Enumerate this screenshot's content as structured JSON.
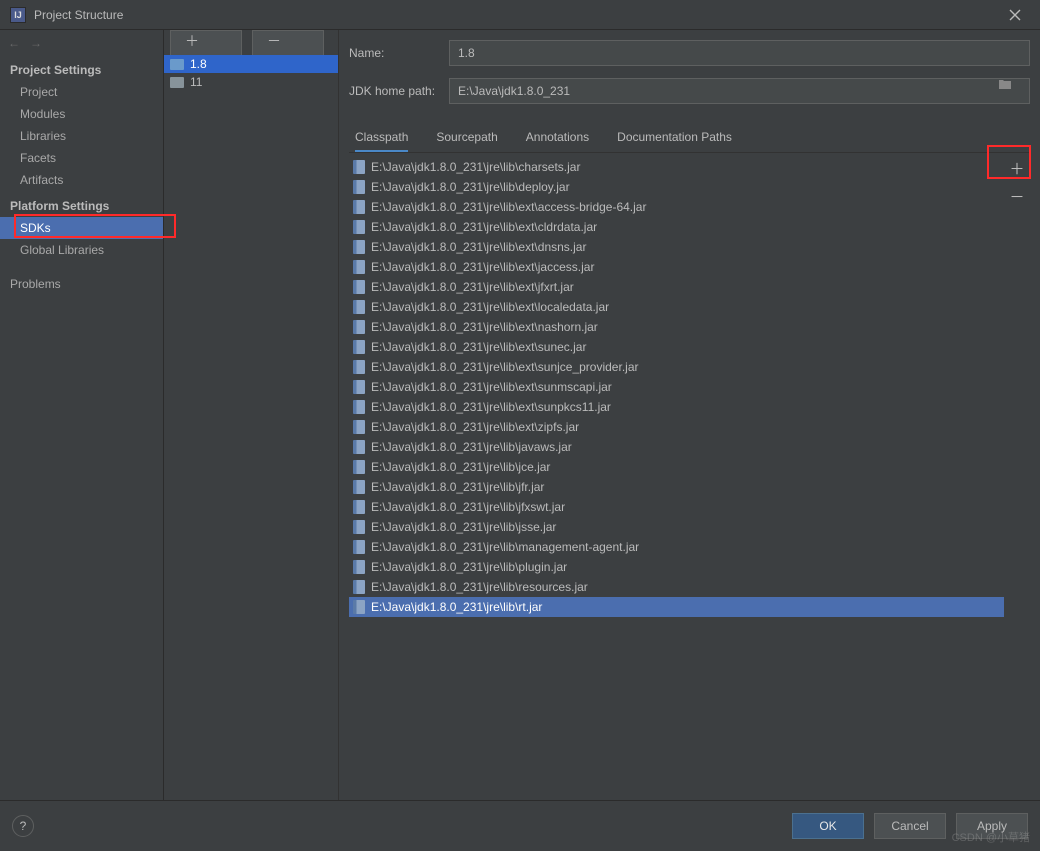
{
  "window": {
    "title": "Project Structure"
  },
  "sidebar": {
    "project_settings_header": "Project Settings",
    "project": "Project",
    "modules": "Modules",
    "libraries": "Libraries",
    "facets": "Facets",
    "artifacts": "Artifacts",
    "platform_settings_header": "Platform Settings",
    "sdks": "SDKs",
    "global_libraries": "Global Libraries",
    "problems": "Problems"
  },
  "sdk_list": {
    "items": [
      {
        "label": "1.8",
        "selected": true
      },
      {
        "label": "11",
        "selected": false
      }
    ]
  },
  "form": {
    "name_label": "Name:",
    "name_value": "1.8",
    "jdk_path_label": "JDK home path:",
    "jdk_path_value": "E:\\Java\\jdk1.8.0_231"
  },
  "tabs": {
    "classpath": "Classpath",
    "sourcepath": "Sourcepath",
    "annotations": "Annotations",
    "docpaths": "Documentation Paths"
  },
  "classpath": {
    "items": [
      "E:\\Java\\jdk1.8.0_231\\jre\\lib\\charsets.jar",
      "E:\\Java\\jdk1.8.0_231\\jre\\lib\\deploy.jar",
      "E:\\Java\\jdk1.8.0_231\\jre\\lib\\ext\\access-bridge-64.jar",
      "E:\\Java\\jdk1.8.0_231\\jre\\lib\\ext\\cldrdata.jar",
      "E:\\Java\\jdk1.8.0_231\\jre\\lib\\ext\\dnsns.jar",
      "E:\\Java\\jdk1.8.0_231\\jre\\lib\\ext\\jaccess.jar",
      "E:\\Java\\jdk1.8.0_231\\jre\\lib\\ext\\jfxrt.jar",
      "E:\\Java\\jdk1.8.0_231\\jre\\lib\\ext\\localedata.jar",
      "E:\\Java\\jdk1.8.0_231\\jre\\lib\\ext\\nashorn.jar",
      "E:\\Java\\jdk1.8.0_231\\jre\\lib\\ext\\sunec.jar",
      "E:\\Java\\jdk1.8.0_231\\jre\\lib\\ext\\sunjce_provider.jar",
      "E:\\Java\\jdk1.8.0_231\\jre\\lib\\ext\\sunmscapi.jar",
      "E:\\Java\\jdk1.8.0_231\\jre\\lib\\ext\\sunpkcs11.jar",
      "E:\\Java\\jdk1.8.0_231\\jre\\lib\\ext\\zipfs.jar",
      "E:\\Java\\jdk1.8.0_231\\jre\\lib\\javaws.jar",
      "E:\\Java\\jdk1.8.0_231\\jre\\lib\\jce.jar",
      "E:\\Java\\jdk1.8.0_231\\jre\\lib\\jfr.jar",
      "E:\\Java\\jdk1.8.0_231\\jre\\lib\\jfxswt.jar",
      "E:\\Java\\jdk1.8.0_231\\jre\\lib\\jsse.jar",
      "E:\\Java\\jdk1.8.0_231\\jre\\lib\\management-agent.jar",
      "E:\\Java\\jdk1.8.0_231\\jre\\lib\\plugin.jar",
      "E:\\Java\\jdk1.8.0_231\\jre\\lib\\resources.jar",
      "E:\\Java\\jdk1.8.0_231\\jre\\lib\\rt.jar"
    ],
    "selected_index": 22
  },
  "footer": {
    "ok": "OK",
    "cancel": "Cancel",
    "apply": "Apply"
  },
  "watermark": "CSDN @小草猪"
}
